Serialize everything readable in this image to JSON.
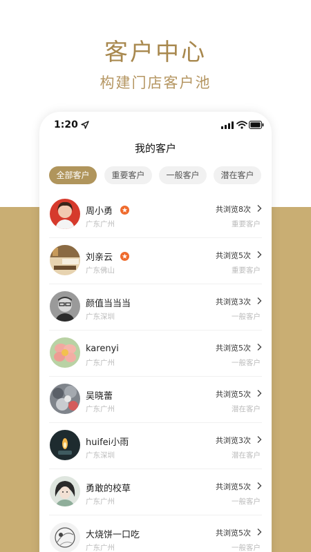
{
  "promo": {
    "title": "客户中心",
    "subtitle": "构建门店客户池"
  },
  "status_bar": {
    "time": "1:20",
    "icons": [
      "location-arrow-icon",
      "signal-icon",
      "wifi-icon",
      "battery-icon"
    ]
  },
  "page": {
    "title": "我的客户"
  },
  "tabs": [
    {
      "label": "全部客户",
      "active": true
    },
    {
      "label": "重要客户",
      "active": false
    },
    {
      "label": "一般客户",
      "active": false
    },
    {
      "label": "潜在客户",
      "active": false
    }
  ],
  "customers": [
    {
      "name": "周小勇",
      "starred": true,
      "city": "广东广州",
      "views": "共浏览8次",
      "level": "重要客户"
    },
    {
      "name": "刘亲云",
      "starred": true,
      "city": "广东佛山",
      "views": "共浏览5次",
      "level": "重要客户"
    },
    {
      "name": "颜值当当当",
      "starred": false,
      "city": "广东深圳",
      "views": "共浏览3次",
      "level": "一般客户"
    },
    {
      "name": "karenyi",
      "starred": false,
      "city": "广东广州",
      "views": "共浏览5次",
      "level": "一般客户"
    },
    {
      "name": "吴晓蕾",
      "starred": false,
      "city": "广东广州",
      "views": "共浏览5次",
      "level": "潜在客户"
    },
    {
      "name": "huifei小雨",
      "starred": false,
      "city": "广东深圳",
      "views": "共浏览3次",
      "level": "潜在客户"
    },
    {
      "name": "勇敢的校草",
      "starred": false,
      "city": "广东广州",
      "views": "共浏览5次",
      "level": "一般客户"
    },
    {
      "name": "大烧饼一口吃",
      "starred": false,
      "city": "广东广州",
      "views": "共浏览5次",
      "level": "一般客户"
    }
  ],
  "colors": {
    "accent": "#b0955c",
    "promo_text": "#a8884e",
    "bottom_band": "#c9ae73",
    "star_badge": "#ef6b2d"
  }
}
